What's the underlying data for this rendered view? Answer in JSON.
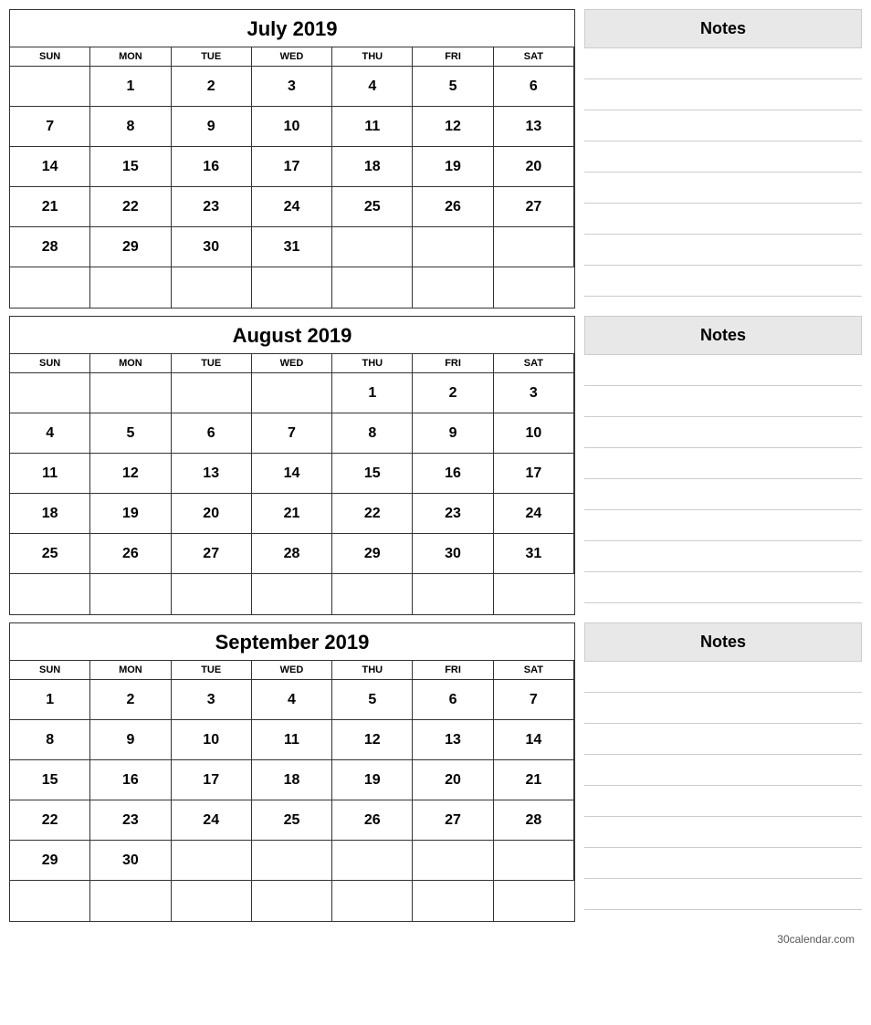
{
  "months": [
    {
      "title": "July 2019",
      "headers": [
        "SUN",
        "MON",
        "TUE",
        "WED",
        "THU",
        "FRI",
        "SAT"
      ],
      "weeks": [
        [
          "",
          "1",
          "2",
          "3",
          "4",
          "5",
          "6"
        ],
        [
          "7",
          "8",
          "9",
          "10",
          "11",
          "12",
          "13"
        ],
        [
          "14",
          "15",
          "16",
          "17",
          "18",
          "19",
          "20"
        ],
        [
          "21",
          "22",
          "23",
          "24",
          "25",
          "26",
          "27"
        ],
        [
          "28",
          "29",
          "30",
          "31",
          "",
          "",
          ""
        ],
        [
          "",
          "",
          "",
          "",
          "",
          "",
          ""
        ]
      ]
    },
    {
      "title": "August 2019",
      "headers": [
        "SUN",
        "MON",
        "TUE",
        "WED",
        "THU",
        "FRI",
        "SAT"
      ],
      "weeks": [
        [
          "",
          "",
          "",
          "",
          "1",
          "2",
          "3"
        ],
        [
          "4",
          "5",
          "6",
          "7",
          "8",
          "9",
          "10"
        ],
        [
          "11",
          "12",
          "13",
          "14",
          "15",
          "16",
          "17"
        ],
        [
          "18",
          "19",
          "20",
          "21",
          "22",
          "23",
          "24"
        ],
        [
          "25",
          "26",
          "27",
          "28",
          "29",
          "30",
          "31"
        ],
        [
          "",
          "",
          "",
          "",
          "",
          "",
          ""
        ]
      ]
    },
    {
      "title": "September 2019",
      "headers": [
        "SUN",
        "MON",
        "TUE",
        "WED",
        "THU",
        "FRI",
        "SAT"
      ],
      "weeks": [
        [
          "1",
          "2",
          "3",
          "4",
          "5",
          "6",
          "7"
        ],
        [
          "8",
          "9",
          "10",
          "11",
          "12",
          "13",
          "14"
        ],
        [
          "15",
          "16",
          "17",
          "18",
          "19",
          "20",
          "21"
        ],
        [
          "22",
          "23",
          "24",
          "25",
          "26",
          "27",
          "28"
        ],
        [
          "29",
          "30",
          "",
          "",
          "",
          "",
          ""
        ],
        [
          "",
          "",
          "",
          "",
          "",
          "",
          ""
        ]
      ]
    }
  ],
  "notes_label": "Notes",
  "footer": "30calendar.com",
  "notes_lines_count": 8
}
